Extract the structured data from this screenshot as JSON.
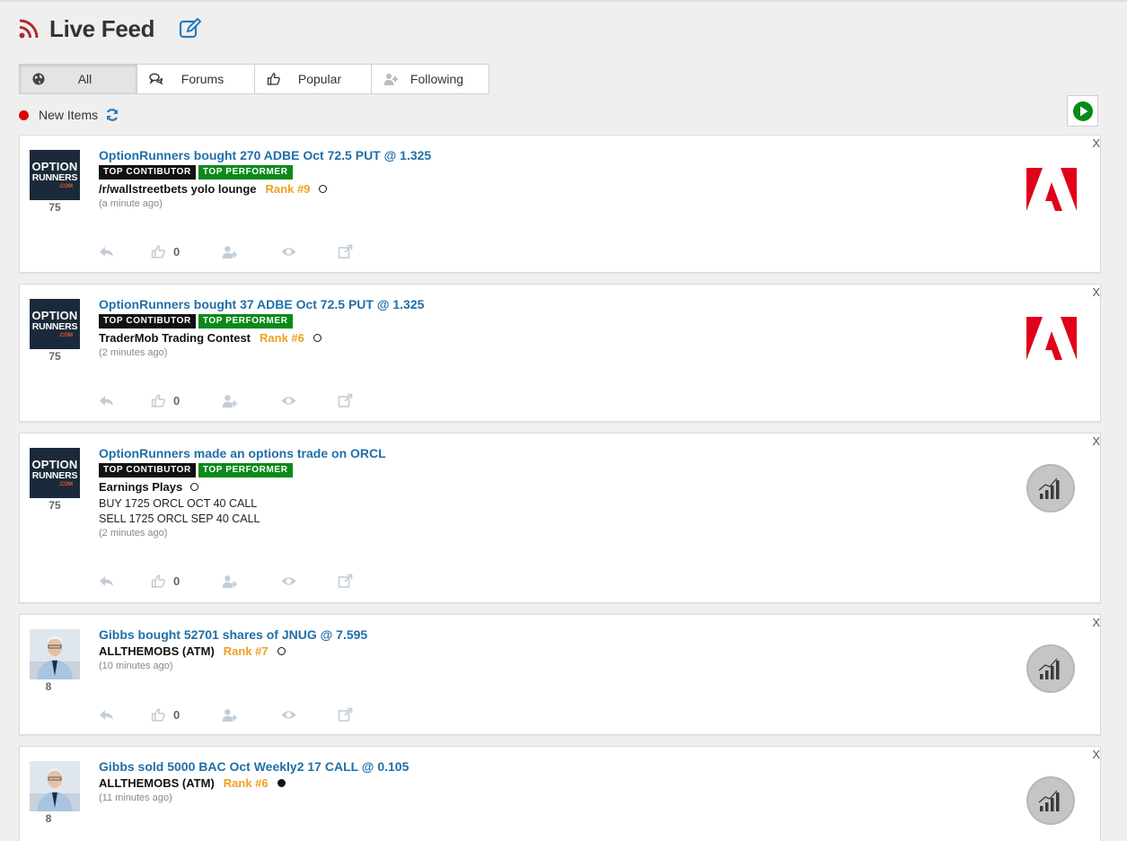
{
  "header": {
    "title": "Live Feed",
    "icon": "rss-icon",
    "edit_icon": "edit-icon",
    "accent": "#b22b2b"
  },
  "tabs": [
    {
      "label": "All",
      "icon": "globe-icon",
      "active": true
    },
    {
      "label": "Forums",
      "icon": "comments-icon",
      "active": false
    },
    {
      "label": "Popular",
      "icon": "thumbs-up-icon",
      "active": false
    },
    {
      "label": "Following",
      "icon": "user-plus-icon",
      "active": false
    }
  ],
  "new_items": {
    "label": "New Items"
  },
  "close_label": "X",
  "logo_text": {
    "line1": "OPTION",
    "line2": "RUNNERS",
    "line3": ".COM"
  },
  "posts": [
    {
      "headline": "OptionRunners bought 270 ADBE Oct 72.5 PUT @ 1.325",
      "badges": [
        "TOP CONTIBUTOR",
        "TOP PERFORMER"
      ],
      "group": "/r/wallstreetbets yolo lounge",
      "rank": "Rank #9",
      "status": "open",
      "trades": [],
      "time": "(a minute ago)",
      "score": "75",
      "likes": "0",
      "ticker_logo": "adobe-logo"
    },
    {
      "headline": "OptionRunners bought 37 ADBE Oct 72.5 PUT @ 1.325",
      "badges": [
        "TOP CONTIBUTOR",
        "TOP PERFORMER"
      ],
      "group": "TraderMob Trading Contest",
      "rank": "Rank #6",
      "status": "open",
      "trades": [],
      "time": "(2 minutes ago)",
      "score": "75",
      "likes": "0",
      "ticker_logo": "adobe-logo"
    },
    {
      "headline": "OptionRunners made an options trade on ORCL",
      "badges": [
        "TOP CONTIBUTOR",
        "TOP PERFORMER"
      ],
      "group": "Earnings Plays",
      "rank": "",
      "status": "open",
      "trades": [
        "BUY 1725 ORCL OCT 40 CALL",
        "SELL 1725 ORCL SEP 40 CALL"
      ],
      "time": "(2 minutes ago)",
      "score": "75",
      "likes": "0",
      "ticker_logo": "chart-icon"
    },
    {
      "headline": "Gibbs bought 52701 shares of JNUG @ 7.595",
      "badges": [],
      "group": "ALLTHEMOBS (ATM)",
      "rank": "Rank #7",
      "status": "open",
      "trades": [],
      "time": "(10 minutes ago)",
      "score": "8",
      "likes": "0",
      "ticker_logo": "chart-icon"
    },
    {
      "headline": "Gibbs sold 5000 BAC Oct Weekly2 17 CALL @ 0.105",
      "badges": [],
      "group": "ALLTHEMOBS (ATM)",
      "rank": "Rank #6",
      "status": "closed",
      "trades": [],
      "time": "(11 minutes ago)",
      "score": "8",
      "likes": "",
      "ticker_logo": "chart-icon"
    }
  ],
  "colors": {
    "link": "#1f6fa8",
    "rank": "#f0a020",
    "badge_black": "#111111",
    "badge_green": "#0a8a1a",
    "new_dot": "#e00000",
    "play": "#0a8a1a",
    "adobe": "#e1001a"
  }
}
